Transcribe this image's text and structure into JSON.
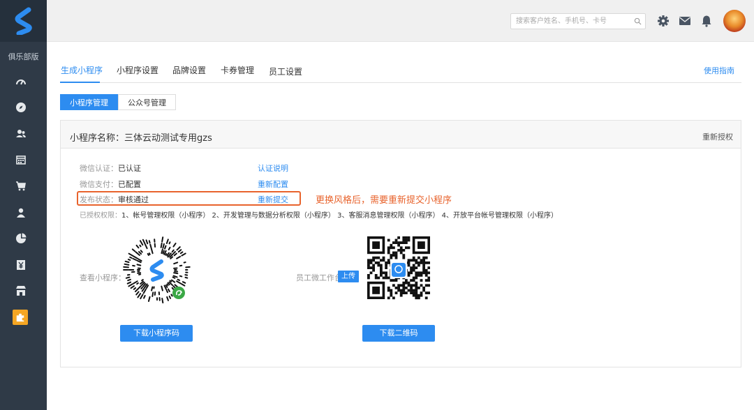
{
  "sidebar": {
    "club_label": "俱乐部版",
    "icons": [
      "dashboard-icon",
      "compass-icon",
      "members-icon",
      "calendar-icon",
      "cart-icon",
      "user-icon",
      "pie-chart-icon",
      "yen-card-icon",
      "store-icon",
      "puzzle-icon"
    ]
  },
  "header": {
    "search_placeholder": "搜索客户姓名、手机号、卡号"
  },
  "tabs": [
    {
      "label": "生成小程序"
    },
    {
      "label": "小程序设置"
    },
    {
      "label": "品牌设置"
    },
    {
      "label": "卡券管理"
    },
    {
      "label": "员工设置"
    }
  ],
  "guide_label": "使用指南",
  "subtabs": [
    {
      "label": "小程序管理"
    },
    {
      "label": "公众号管理"
    }
  ],
  "panel": {
    "title": "小程序名称：三体云动测试专用gzs",
    "reauth_label": "重新授权",
    "rows": {
      "wechat_auth": {
        "label": "微信认证：",
        "value": "已认证",
        "link": "认证说明"
      },
      "wechat_pay": {
        "label": "微信支付：",
        "value": "已配置",
        "link": "重新配置"
      },
      "publish": {
        "label": "发布状态：",
        "value": "审核通过",
        "link": "重新提交"
      },
      "permissions": {
        "label": "已授权权限：",
        "value": "1、帐号管理权限（小程序） 2、开发管理与数据分析权限（小程序） 3、客服消息管理权限（小程序） 4、开放平台帐号管理权限（小程序）"
      }
    },
    "annotation": "更换风格后，需要重新提交小程序",
    "view_miniprogram_label": "查看小程序：",
    "staff_workbench_label": "员工微工作台",
    "upload_label": "上传",
    "download_miniprogram_code": "下载小程序码",
    "download_qrcode": "下载二维码"
  },
  "colors": {
    "accent": "#2d8cf0",
    "sidebar_bg": "#2f3a47",
    "annotation": "#e8632c",
    "active_nav": "#f5a623"
  }
}
